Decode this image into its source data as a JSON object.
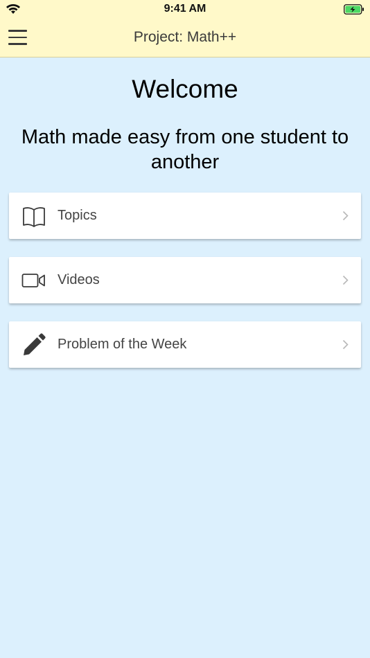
{
  "status_bar": {
    "time": "9:41 AM"
  },
  "nav": {
    "title": "Project: Math++"
  },
  "main": {
    "heading": "Welcome",
    "subtitle": "Math made easy from one student to another"
  },
  "menu_items": [
    {
      "label": "Topics",
      "icon": "book-icon"
    },
    {
      "label": "Videos",
      "icon": "video-camera-icon"
    },
    {
      "label": "Problem of the Week",
      "icon": "pencil-icon"
    }
  ],
  "colors": {
    "background": "#dcf0fd",
    "nav_background": "#fff9c9",
    "card_background": "#ffffff",
    "battery": "#4cd964"
  }
}
